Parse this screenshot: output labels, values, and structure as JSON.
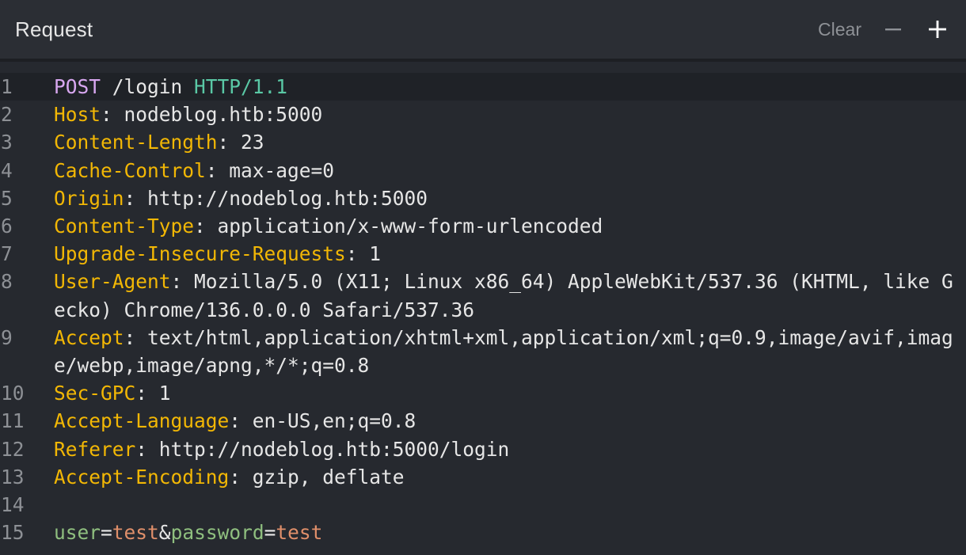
{
  "header": {
    "title": "Request",
    "clear_label": "Clear",
    "minus_icon": "minus-icon",
    "plus_icon": "plus-icon"
  },
  "request": {
    "method": "POST",
    "path": " /login ",
    "protocol": "HTTP/1.1",
    "headers": [
      {
        "key": "Host",
        "value": "nodeblog.htb:5000"
      },
      {
        "key": "Content-Length",
        "value": "23"
      },
      {
        "key": "Cache-Control",
        "value": "max-age=0"
      },
      {
        "key": "Origin",
        "value": "http://nodeblog.htb:5000"
      },
      {
        "key": "Content-Type",
        "value": "application/x-www-form-urlencoded"
      },
      {
        "key": "Upgrade-Insecure-Requests",
        "value": "1"
      },
      {
        "key": "User-Agent",
        "value": "Mozilla/5.0 (X11; Linux x86_64) AppleWebKit/537.36 (KHTML, like Gecko) Chrome/136.0.0.0 Safari/537.36"
      },
      {
        "key": "Accept",
        "value": "text/html,application/xhtml+xml,application/xml;q=0.9,image/avif,image/webp,image/apng,*/*;q=0.8"
      },
      {
        "key": "Sec-GPC",
        "value": "1"
      },
      {
        "key": "Accept-Language",
        "value": "en-US,en;q=0.8"
      },
      {
        "key": "Referer",
        "value": "http://nodeblog.htb:5000/login"
      },
      {
        "key": "Accept-Encoding",
        "value": "gzip, deflate"
      }
    ],
    "body": {
      "p1_key": "user",
      "p1_value": "test",
      "p2_key": "password",
      "p2_value": "test",
      "eq": "=",
      "amp": "&"
    }
  },
  "line_numbers": [
    "1",
    "2",
    "3",
    "4",
    "5",
    "6",
    "7",
    "8",
    "9",
    "10",
    "11",
    "12",
    "13",
    "14",
    "15"
  ],
  "colors": {
    "method": "#d8a7f0",
    "protocol": "#5ac8a5",
    "header_key": "#f2b705",
    "param_key": "#8fbf7f",
    "param_value": "#e08f6a"
  }
}
